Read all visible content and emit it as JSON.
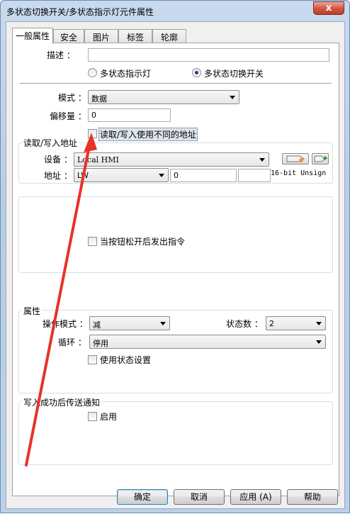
{
  "window": {
    "title": "多状态切换开关/多状态指示灯元件属性",
    "close_glyph": "x"
  },
  "tabs": [
    {
      "label": "一般属性",
      "active": true
    },
    {
      "label": "安全",
      "active": false
    },
    {
      "label": "图片",
      "active": false
    },
    {
      "label": "标签",
      "active": false
    },
    {
      "label": "轮廓",
      "active": false
    }
  ],
  "general": {
    "description_label": "描述 ：",
    "description_value": "",
    "radio_indicator_label": "多状态指示灯",
    "radio_switch_label": "多状态切换开关",
    "selected_type": "多状态切换开关",
    "mode_label": "模式 ：",
    "mode_value": "数据",
    "offset_label": "偏移量 ：",
    "offset_value": "0",
    "use_different_addr_label": "读取/写入使用不同的地址",
    "use_different_addr_checked": false
  },
  "rw_address": {
    "group_title": "读取/写入地址",
    "device_label": "设备 ：",
    "device_value": "Local HMI",
    "address_label": "地址 ：",
    "address_type_value": "LW",
    "address_value": "0",
    "address_extra_value": "",
    "data_format": "16-bit Unsign"
  },
  "release_option": {
    "label": "当按钮松开后发出指令",
    "checked": false
  },
  "attributes": {
    "group_title": "属性",
    "op_mode_label": "操作模式 ：",
    "op_mode_value": "减",
    "state_count_label": "状态数 ：",
    "state_count_value": "2",
    "loop_label": "循环 ：",
    "loop_value": "停用",
    "use_state_setting_label": "使用状态设置",
    "use_state_setting_checked": false
  },
  "notify": {
    "group_title": "写入成功后传送通知",
    "enable_label": "启用",
    "enable_checked": false
  },
  "footer": {
    "ok_label": "确定",
    "cancel_label": "取消",
    "apply_label": "应用 (A)",
    "help_label": "帮助"
  },
  "colors": {
    "annotation_arrow": "#e8332a",
    "title_bar": "#c4d6ec",
    "close_button": "#c8432b"
  }
}
